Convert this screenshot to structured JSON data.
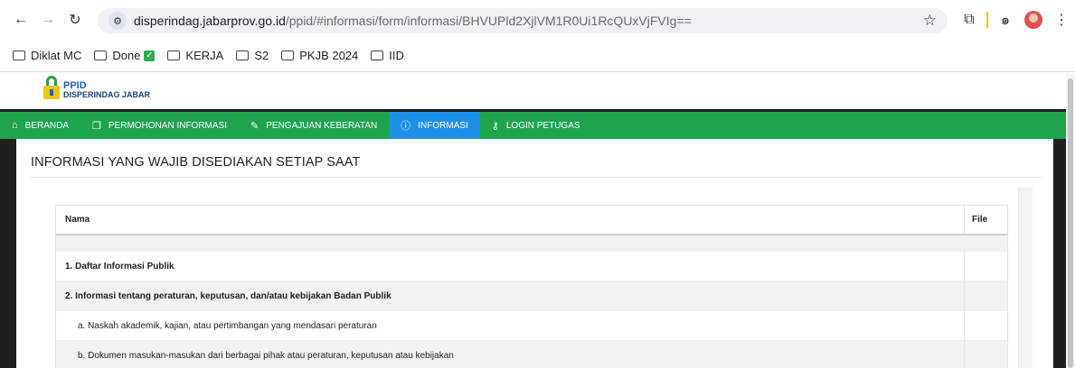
{
  "browser": {
    "url_host": "disperindag.jabarprov.go.id",
    "url_path": "/ppid/#informasi/form/informasi/BHVUPld2XjlVM1R0Ui1RcQUxVjFVIg==",
    "bookmarks": [
      {
        "label": "Diklat MC"
      },
      {
        "label": "Done"
      },
      {
        "label": "KERJA"
      },
      {
        "label": "S2"
      },
      {
        "label": "PKJB 2024"
      },
      {
        "label": "IID"
      }
    ]
  },
  "site": {
    "logo_line1": "PPID",
    "logo_line2": "DISPERINDAG JABAR",
    "nav": [
      {
        "label": "BERANDA",
        "icon": "home-icon",
        "active": false
      },
      {
        "label": "PERMOHONAN INFORMASI",
        "icon": "document-icon",
        "active": false
      },
      {
        "label": "PENGAJUAN KEBERATAN",
        "icon": "edit-icon",
        "active": false
      },
      {
        "label": "INFORMASI",
        "icon": "info-icon",
        "active": true
      },
      {
        "label": "LOGIN PETUGAS",
        "icon": "key-icon",
        "active": false
      }
    ]
  },
  "main": {
    "title": "INFORMASI YANG WAJIB DISEDIAKAN SETIAP SAAT",
    "table": {
      "col_name": "Nama",
      "col_file": "File",
      "rows": [
        {
          "text": "1. Daftar Informasi Publik",
          "file": ""
        },
        {
          "text": "2. Informasi tentang peraturan, keputusan, dan/atau kebijakan Badan Publik",
          "file": ""
        },
        {
          "text": "a. Naskah akademik, kajian, atau pertimbangan yang mendasari peraturan",
          "file": ""
        },
        {
          "text": "b. Dokumen masukan-masukan dari berbagai pihak atau peraturan, keputusan atau kebijakan",
          "file": ""
        }
      ]
    }
  },
  "colors": {
    "nav_green": "#1fa44e",
    "nav_active": "#1e90e8"
  }
}
